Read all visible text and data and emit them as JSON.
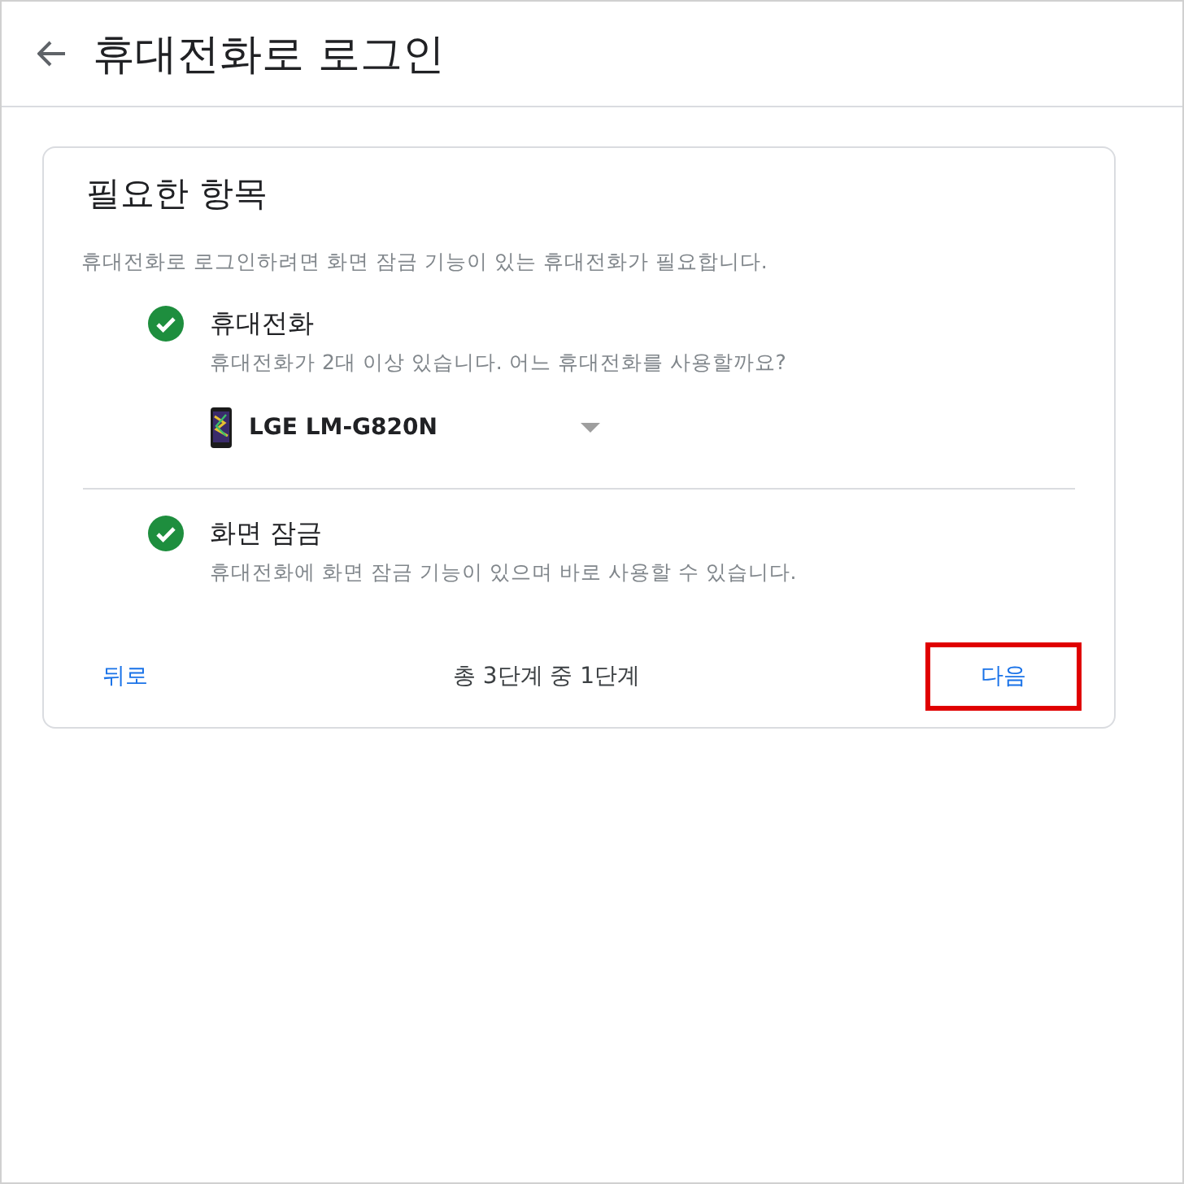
{
  "header": {
    "title": "휴대전화로 로그인"
  },
  "card": {
    "title": "필요한 항목",
    "description": "휴대전화로 로그인하려면 화면 잠금 기능이 있는 휴대전화가 필요합니다.",
    "requirements": [
      {
        "title": "휴대전화",
        "detail": "휴대전화가 2대 이상 있습니다. 어느 휴대전화를 사용할까요?",
        "checked": true,
        "device": {
          "value": "LGE LM-G820N"
        }
      },
      {
        "title": "화면 잠금",
        "detail": "휴대전화에 화면 잠금 기능이 있으며 바로 사용할 수 있습니다.",
        "checked": true
      }
    ],
    "footer": {
      "back": "뒤로",
      "progress": "총 3단계 중 1단계",
      "next": {
        "label": "다음",
        "highlighted": true
      }
    }
  }
}
